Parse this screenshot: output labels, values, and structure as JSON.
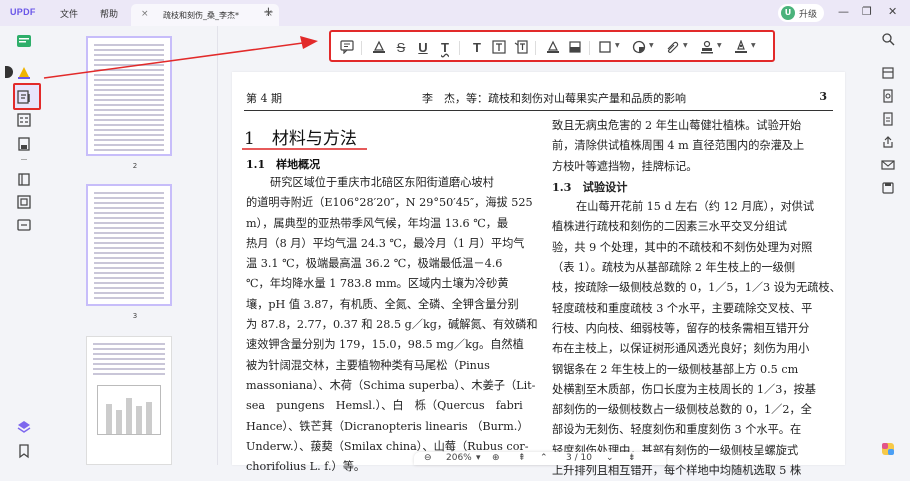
{
  "app": {
    "logo": "UPDF",
    "menu": [
      "文件",
      "帮助"
    ],
    "tab_title": "疏枝和刻伤_桑_李杰*",
    "upgrade_label": "升级",
    "upgrade_avatar": "U"
  },
  "thumbnails": {
    "pages": [
      "2",
      "3"
    ]
  },
  "toolbar": {
    "tools": [
      "comment-icon",
      "highlight-icon",
      "strikethrough-icon",
      "underline-icon",
      "squiggly-icon",
      "text-icon",
      "text-box-icon",
      "text-callout-icon",
      "pencil-icon",
      "eraser-icon",
      "shape-icon",
      "sticker-icon",
      "attach-icon",
      "stamp-icon",
      "signature-icon"
    ],
    "accent_color": "#e22a2a"
  },
  "page": {
    "header_left": "第 4 期",
    "header_mid": "李　杰，等：疏枝和刻伤对山莓果实产量和品质的影响",
    "header_num": "3",
    "section_title": "1　材料与方法",
    "sub_title": "1.1　样地概况",
    "left_col": [
      "研究区域位于重庆市北碚区东阳街道磨心坡村",
      "的道明寺附近（E106°28′20″，N 29°50′45″，海拔 525",
      "m），属典型的亚热带季风气候，年均温 13.6 ℃，最",
      "热月（8 月）平均气温 24.3 ℃，最冷月（1 月）平均气",
      "温 3.1 ℃，极端最高温 36.2 ℃，极端最低温－4.6",
      "℃，年均降水量 1 783.8 mm。区域内土壤为冷砂黄",
      "壤，pH 值 3.87，有机质、全氮、全磷、全钾含量分别",
      "为 87.8，2.77，0.37 和 28.5 g／kg，碱解氮、有效磷和",
      "速效钾含量分别为 179，15.0，98.5 mg／kg。自然植",
      "被为针阔混交林，主要植物种类有马尾松（Pinus",
      "massoniana）、木荷（Schima superba）、木姜子（Lit-",
      "sea　pungens　Hemsl.）、白　栎（Quercus　fabri",
      "Hance）、铁芒萁（Dicranopteris linearis （Burm.）",
      "Underw.）、菝葜（Smilax china）、山莓（Rubus cor-",
      "chorifolius L. f.）等。"
    ],
    "right_col": [
      "致且无病虫危害的 2 年生山莓健壮植株。试验开始",
      "前，清除供试植株周围 4 m 直径范围内的杂灌及上",
      "方枝叶等遮挡物，挂牌标记。",
      "1.3　试验设计",
      "在山莓开花前 15 d 左右（约 12 月底），对供试",
      "植株进行疏枝和刻伤的二因素三水平交叉分组试",
      "验，共 9 个处理，其中的不疏枝和不刻伤处理为对照",
      "（表 1）。疏枝为从基部疏除 2 年生枝上的一级侧",
      "枝，按疏除一级侧枝总数的 0，1／5，1／3 设为无疏枝、",
      "轻度疏枝和重度疏枝 3 个水平，主要疏除交叉枝、平",
      "行枝、内向枝、细弱枝等，留存的枝条需相互错开分",
      "布在主枝上，以保证树形通风透光良好；刻伤为用小",
      "钢锯条在 2 年生枝上的一级侧枝基部上方 0.5 cm",
      "处横割至木质部，伤口长度为主枝周长的 1／3，按基",
      "部刻伤的一级侧枝数占一级侧枝总数的 0，1／2，全",
      "部设为无刻伤、轻度刻伤和重度刻伤 3 个水平。在",
      "轻度刻伤处理中，基部有刻伤的一级侧枝呈螺旋式",
      "上升排列且相互错开，每个样地中均随机选取 5 株"
    ]
  },
  "navbar": {
    "zoom": "206%",
    "page_indicator": "3 / 10"
  }
}
